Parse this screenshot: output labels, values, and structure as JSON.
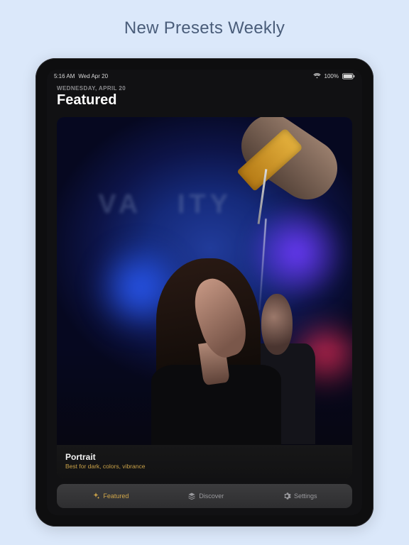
{
  "marketing": {
    "headline": "New Presets Weekly"
  },
  "status_bar": {
    "time": "5:16 AM",
    "date": "Wed Apr 20",
    "battery": "100%"
  },
  "header": {
    "date_label": "WEDNESDAY, APRIL 20",
    "title": "Featured"
  },
  "card": {
    "name": "Portrait",
    "description": "Best for dark, colors, vibrance"
  },
  "tabs": {
    "items": [
      {
        "label": "Featured",
        "active": true
      },
      {
        "label": "Discover",
        "active": false
      },
      {
        "label": "Settings",
        "active": false
      }
    ]
  }
}
